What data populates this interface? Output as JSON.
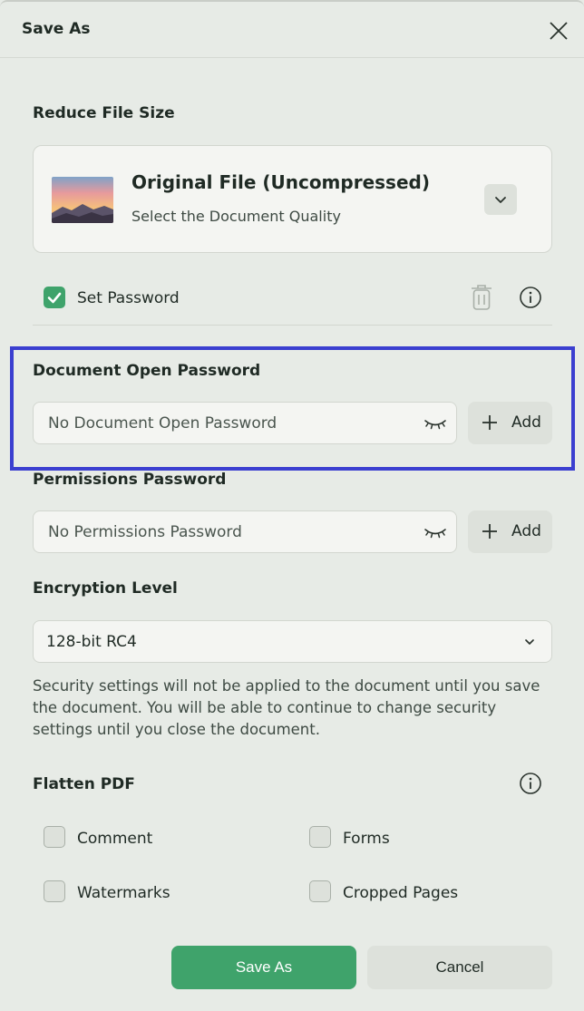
{
  "dialog": {
    "title": "Save As",
    "close_icon": "close-icon"
  },
  "reduce_file_size": {
    "label": "Reduce File Size",
    "card_title": "Original File (Uncompressed)",
    "card_subtitle": "Select the Document Quality",
    "dropdown_icon": "chevron-down-icon"
  },
  "set_password": {
    "label": "Set Password",
    "checked": true,
    "delete_icon": "trash-icon",
    "info_icon": "info-icon"
  },
  "open_password": {
    "label": "Document Open Password",
    "placeholder": "No Document Open Password",
    "eye_icon": "eye-closed-icon",
    "add_label": "Add"
  },
  "permissions_password": {
    "label": "Permissions Password",
    "placeholder": "No Permissions Password",
    "eye_icon": "eye-closed-icon",
    "add_label": "Add"
  },
  "encryption": {
    "label": "Encryption Level",
    "value": "128-bit RC4"
  },
  "note": "Security settings will not be applied to the document until you save the document. You will be able to continue to change security settings until you close the document.",
  "flatten": {
    "label": "Flatten PDF",
    "info_icon": "info-icon",
    "options": [
      {
        "label": "Comment",
        "checked": false
      },
      {
        "label": "Forms",
        "checked": false
      },
      {
        "label": "Watermarks",
        "checked": false
      },
      {
        "label": "Cropped Pages",
        "checked": false
      }
    ]
  },
  "footer": {
    "save_label": "Save As",
    "cancel_label": "Cancel"
  },
  "colors": {
    "accent": "#3fa36b",
    "highlight": "#3b3fd0",
    "background": "#e7ebe6"
  }
}
